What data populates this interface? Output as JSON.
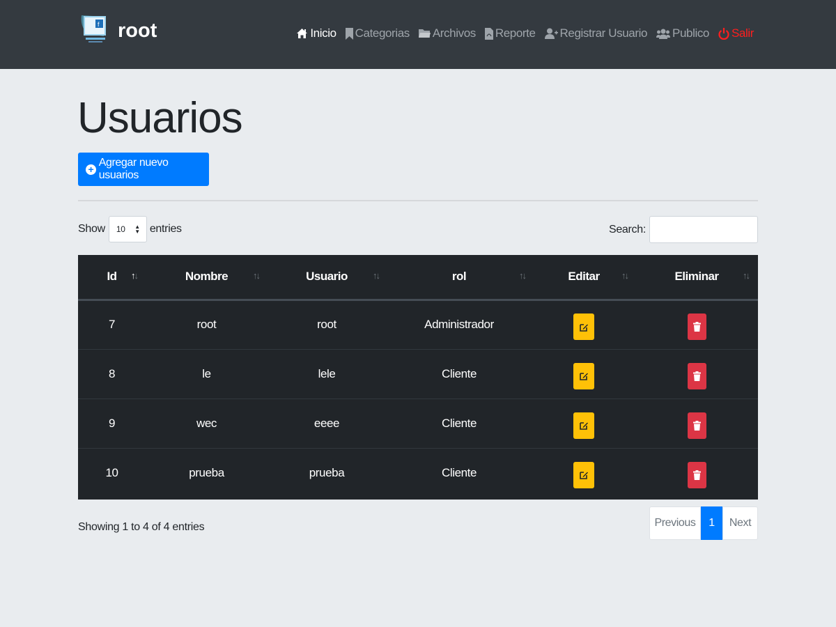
{
  "navbar": {
    "brand": "root",
    "links": [
      {
        "label": "Inicio",
        "icon": "home-icon"
      },
      {
        "label": "Categorias",
        "icon": "bookmark-icon"
      },
      {
        "label": "Archivos",
        "icon": "folder-icon"
      },
      {
        "label": "Reporte",
        "icon": "pdf-file-icon"
      },
      {
        "label": "Registrar Usuario",
        "icon": "user-plus-icon"
      },
      {
        "label": "Publico",
        "icon": "users-icon"
      },
      {
        "label": "Salir",
        "icon": "power-icon"
      }
    ]
  },
  "page": {
    "title": "Usuarios",
    "add_button": "Agregar nuevo usuarios"
  },
  "table_controls": {
    "show_label": "Show",
    "entries_value": "10",
    "entries_label": "entries",
    "search_label": "Search:"
  },
  "table": {
    "headers": [
      "Id",
      "Nombre",
      "Usuario",
      "rol",
      "Editar",
      "Eliminar"
    ],
    "rows": [
      {
        "id": "7",
        "nombre": "root",
        "usuario": "root",
        "rol": "Administrador"
      },
      {
        "id": "8",
        "nombre": "le",
        "usuario": "lele",
        "rol": "Cliente"
      },
      {
        "id": "9",
        "nombre": "wec",
        "usuario": "eeee",
        "rol": "Cliente"
      },
      {
        "id": "10",
        "nombre": "prueba",
        "usuario": "prueba",
        "rol": "Cliente"
      }
    ]
  },
  "footer": {
    "info": "Showing 1 to 4 of 4 entries",
    "previous": "Previous",
    "current_page": "1",
    "next": "Next"
  },
  "colors": {
    "navbar": "#343a40",
    "primary": "#007bff",
    "warning": "#ffc107",
    "danger": "#dc3545",
    "table_dark": "#212529"
  }
}
